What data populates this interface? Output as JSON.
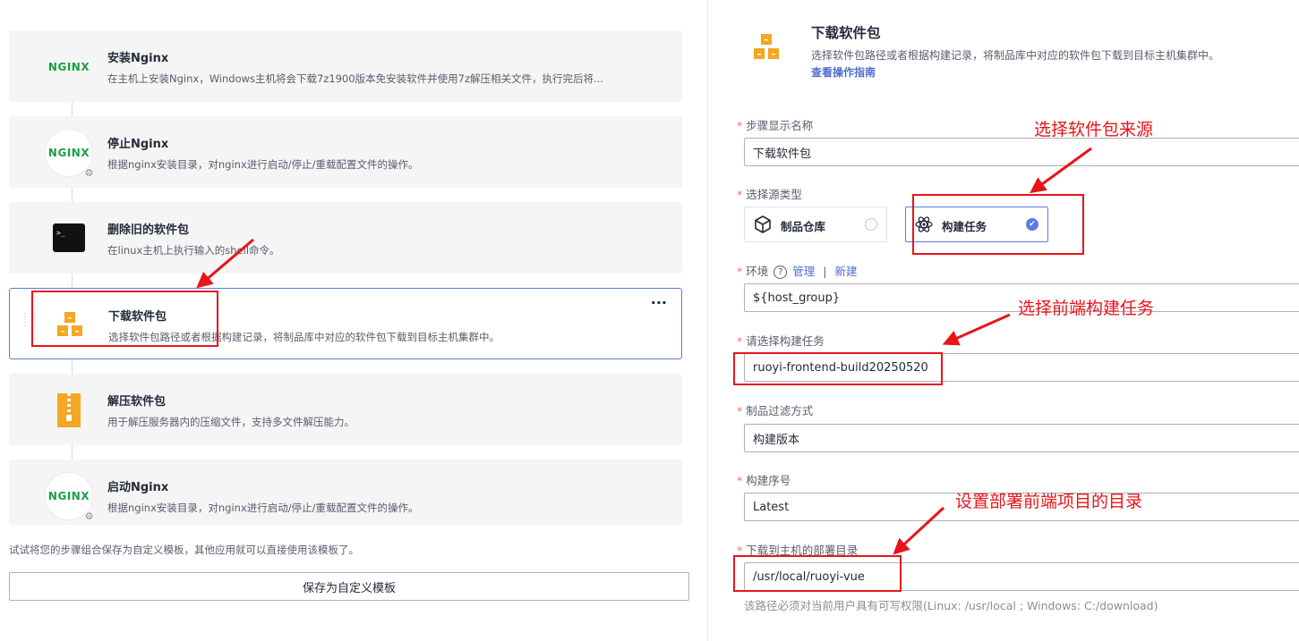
{
  "steps": [
    {
      "title": "安装Nginx",
      "desc": "在主机上安装Nginx，Windows主机将会下载7z1900版本免安装软件并使用7z解压相关文件，执行完后将...",
      "icon": "nginx-icon"
    },
    {
      "title": "停止Nginx",
      "desc": "根据nginx安装目录，对nginx进行启动/停止/重载配置文件的操作。",
      "icon": "nginx-icon"
    },
    {
      "title": "删除旧的软件包",
      "desc": "在linux主机上执行输入的shell命令。",
      "icon": "terminal-icon"
    },
    {
      "title": "下载软件包",
      "desc": "选择软件包路径或者根据构建记录，将制品库中对应的软件包下载到目标主机集群中。",
      "icon": "package-icon"
    },
    {
      "title": "解压软件包",
      "desc": "用于解压服务器内的压缩文件，支持多文件解压能力。",
      "icon": "zip-icon"
    },
    {
      "title": "启动Nginx",
      "desc": "根据nginx安装目录，对nginx进行启动/停止/重载配置文件的操作。",
      "icon": "nginx-icon"
    }
  ],
  "nginx_logo_text": "NGINX",
  "more_label": "···",
  "template_hint": "试试将您的步骤组合保存为自定义模板，其他应用就可以直接使用该模板了。",
  "save_template_label": "保存为自定义模板",
  "panel": {
    "title": "下载软件包",
    "desc": "选择软件包路径或者根据构建记录，将制品库中对应的软件包下载到目标主机集群中。",
    "guide_link": "查看操作指南"
  },
  "form": {
    "step_name_label": "步骤显示名称",
    "step_name_value": "下载软件包",
    "source_type_label": "选择源类型",
    "source_options": [
      {
        "label": "制品仓库",
        "checked": false
      },
      {
        "label": "构建任务",
        "checked": true
      }
    ],
    "env_label": "环境",
    "env_help": "?",
    "env_manage": "管理",
    "env_sep": "|",
    "env_new": "新建",
    "env_value": "${host_group}",
    "build_task_label": "请选择构建任务",
    "build_task_value": "ruoyi-frontend-build20250520",
    "filter_label": "制品过滤方式",
    "filter_value": "构建版本",
    "build_no_label": "构建序号",
    "build_no_value": "Latest",
    "deploy_dir_label": "下载到主机的部署目录",
    "deploy_dir_value": "/usr/local/ruoyi-vue",
    "deploy_dir_hint": "该路径必须对当前用户具有可写权限(Linux: /usr/local ; Windows: C:/download)",
    "required_mark": "*"
  },
  "annotations": {
    "select_source": "选择软件包来源",
    "select_build": "选择前端构建任务",
    "set_dir": "设置部署前端项目的目录"
  },
  "colors": {
    "accent": "#5e7ce0",
    "link": "#526ecc",
    "annotation_red": "#e8141a",
    "nginx_green": "#1ba045",
    "package_orange": "#f5a623"
  }
}
